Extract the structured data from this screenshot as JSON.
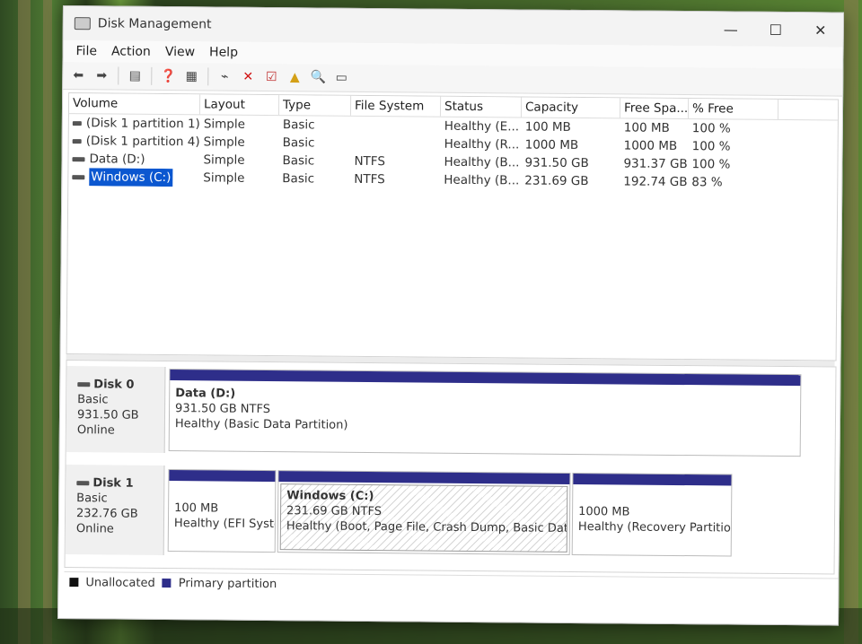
{
  "window": {
    "title": "Disk Management"
  },
  "menu": [
    "File",
    "Action",
    "View",
    "Help"
  ],
  "toolbar": {
    "buttons": [
      "back-icon",
      "forward-icon",
      "console-tree-icon",
      "help-icon",
      "properties-icon",
      "connect-icon",
      "delete-icon",
      "check-icon",
      "folder-up-icon",
      "search-icon",
      "settings-icon"
    ]
  },
  "list": {
    "headers": [
      "Volume",
      "Layout",
      "Type",
      "File System",
      "Status",
      "Capacity",
      "Free Spa...",
      "% Free"
    ],
    "rows": [
      {
        "volume": "(Disk 1 partition 1)",
        "layout": "Simple",
        "type": "Basic",
        "fs": "",
        "status": "Healthy (E...",
        "capacity": "100 MB",
        "free": "100 MB",
        "pct": "100 %"
      },
      {
        "volume": "(Disk 1 partition 4)",
        "layout": "Simple",
        "type": "Basic",
        "fs": "",
        "status": "Healthy (R...",
        "capacity": "1000 MB",
        "free": "1000 MB",
        "pct": "100 %"
      },
      {
        "volume": "Data (D:)",
        "layout": "Simple",
        "type": "Basic",
        "fs": "NTFS",
        "status": "Healthy (B...",
        "capacity": "931.50 GB",
        "free": "931.37 GB",
        "pct": "100 %"
      },
      {
        "volume": "Windows (C:)",
        "layout": "Simple",
        "type": "Basic",
        "fs": "NTFS",
        "status": "Healthy (B...",
        "capacity": "231.69 GB",
        "free": "192.74 GB",
        "pct": "83 %"
      }
    ]
  },
  "disks": {
    "disk0": {
      "name": "Disk 0",
      "type": "Basic",
      "size": "931.50 GB",
      "state": "Online",
      "part_name": "Data  (D:)",
      "part_size": "931.50 GB NTFS",
      "part_status": "Healthy (Basic Data Partition)"
    },
    "disk1": {
      "name": "Disk 1",
      "type": "Basic",
      "size": "232.76 GB",
      "state": "Online",
      "p1_size": "100 MB",
      "p1_status": "Healthy (EFI Syste",
      "p2_name": "Windows  (C:)",
      "p2_size": "231.69 GB NTFS",
      "p2_status": "Healthy (Boot, Page File, Crash Dump, Basic Data Pa",
      "p3_size": "1000 MB",
      "p3_status": "Healthy (Recovery Partition)"
    }
  },
  "legend": {
    "unallocated": "Unallocated",
    "primary": "Primary partition",
    "unallocated_color": "#111111",
    "primary_color": "#2e2e8a"
  },
  "colors": {
    "selection": "#0b57d0",
    "partition_bar": "#2e2e8a"
  }
}
